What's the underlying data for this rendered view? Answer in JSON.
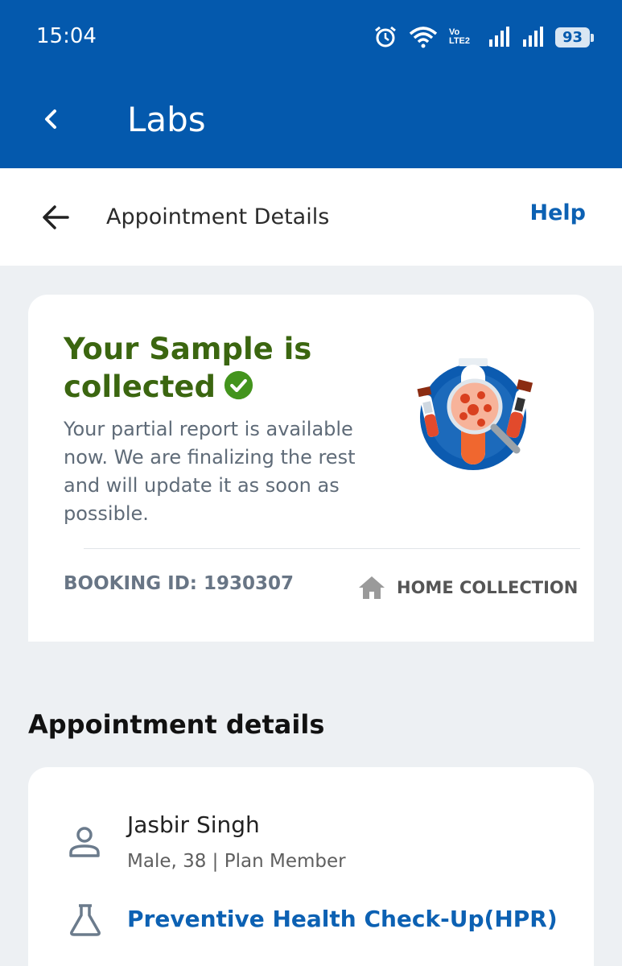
{
  "status_bar": {
    "time": "15:04",
    "icons": [
      "alarm-icon",
      "wifi-icon",
      "volte-icon",
      "signal-icon",
      "signal-icon",
      "battery-icon"
    ],
    "volte_label_1": "Vo",
    "volte_label_2": "LTE2",
    "battery_level": "93"
  },
  "app_bar": {
    "title": "Labs",
    "back_icon": "chevron-left-icon"
  },
  "sub_header": {
    "title": "Appointment Details",
    "help_label": "Help",
    "back_icon": "arrow-left-icon"
  },
  "status_card": {
    "headline": "Your Sample is collected",
    "description": "Your partial report is available now. We are finalizing the rest and will update it as soon as possible.",
    "booking_id": "BOOKING ID: 1930307",
    "collection_type": "HOME COLLECTION",
    "colors": {
      "headline": "#3b6610",
      "check": "#43941d"
    }
  },
  "appointment": {
    "section_title": "Appointment details",
    "patient_name": "Jasbir Singh",
    "patient_meta": "Male, 38 | Plan Member",
    "test_name": "Preventive Health Check-Up(HPR)"
  },
  "colors": {
    "brand": "#0459ad",
    "link": "#0c61b3",
    "background": "#edf0f3"
  }
}
